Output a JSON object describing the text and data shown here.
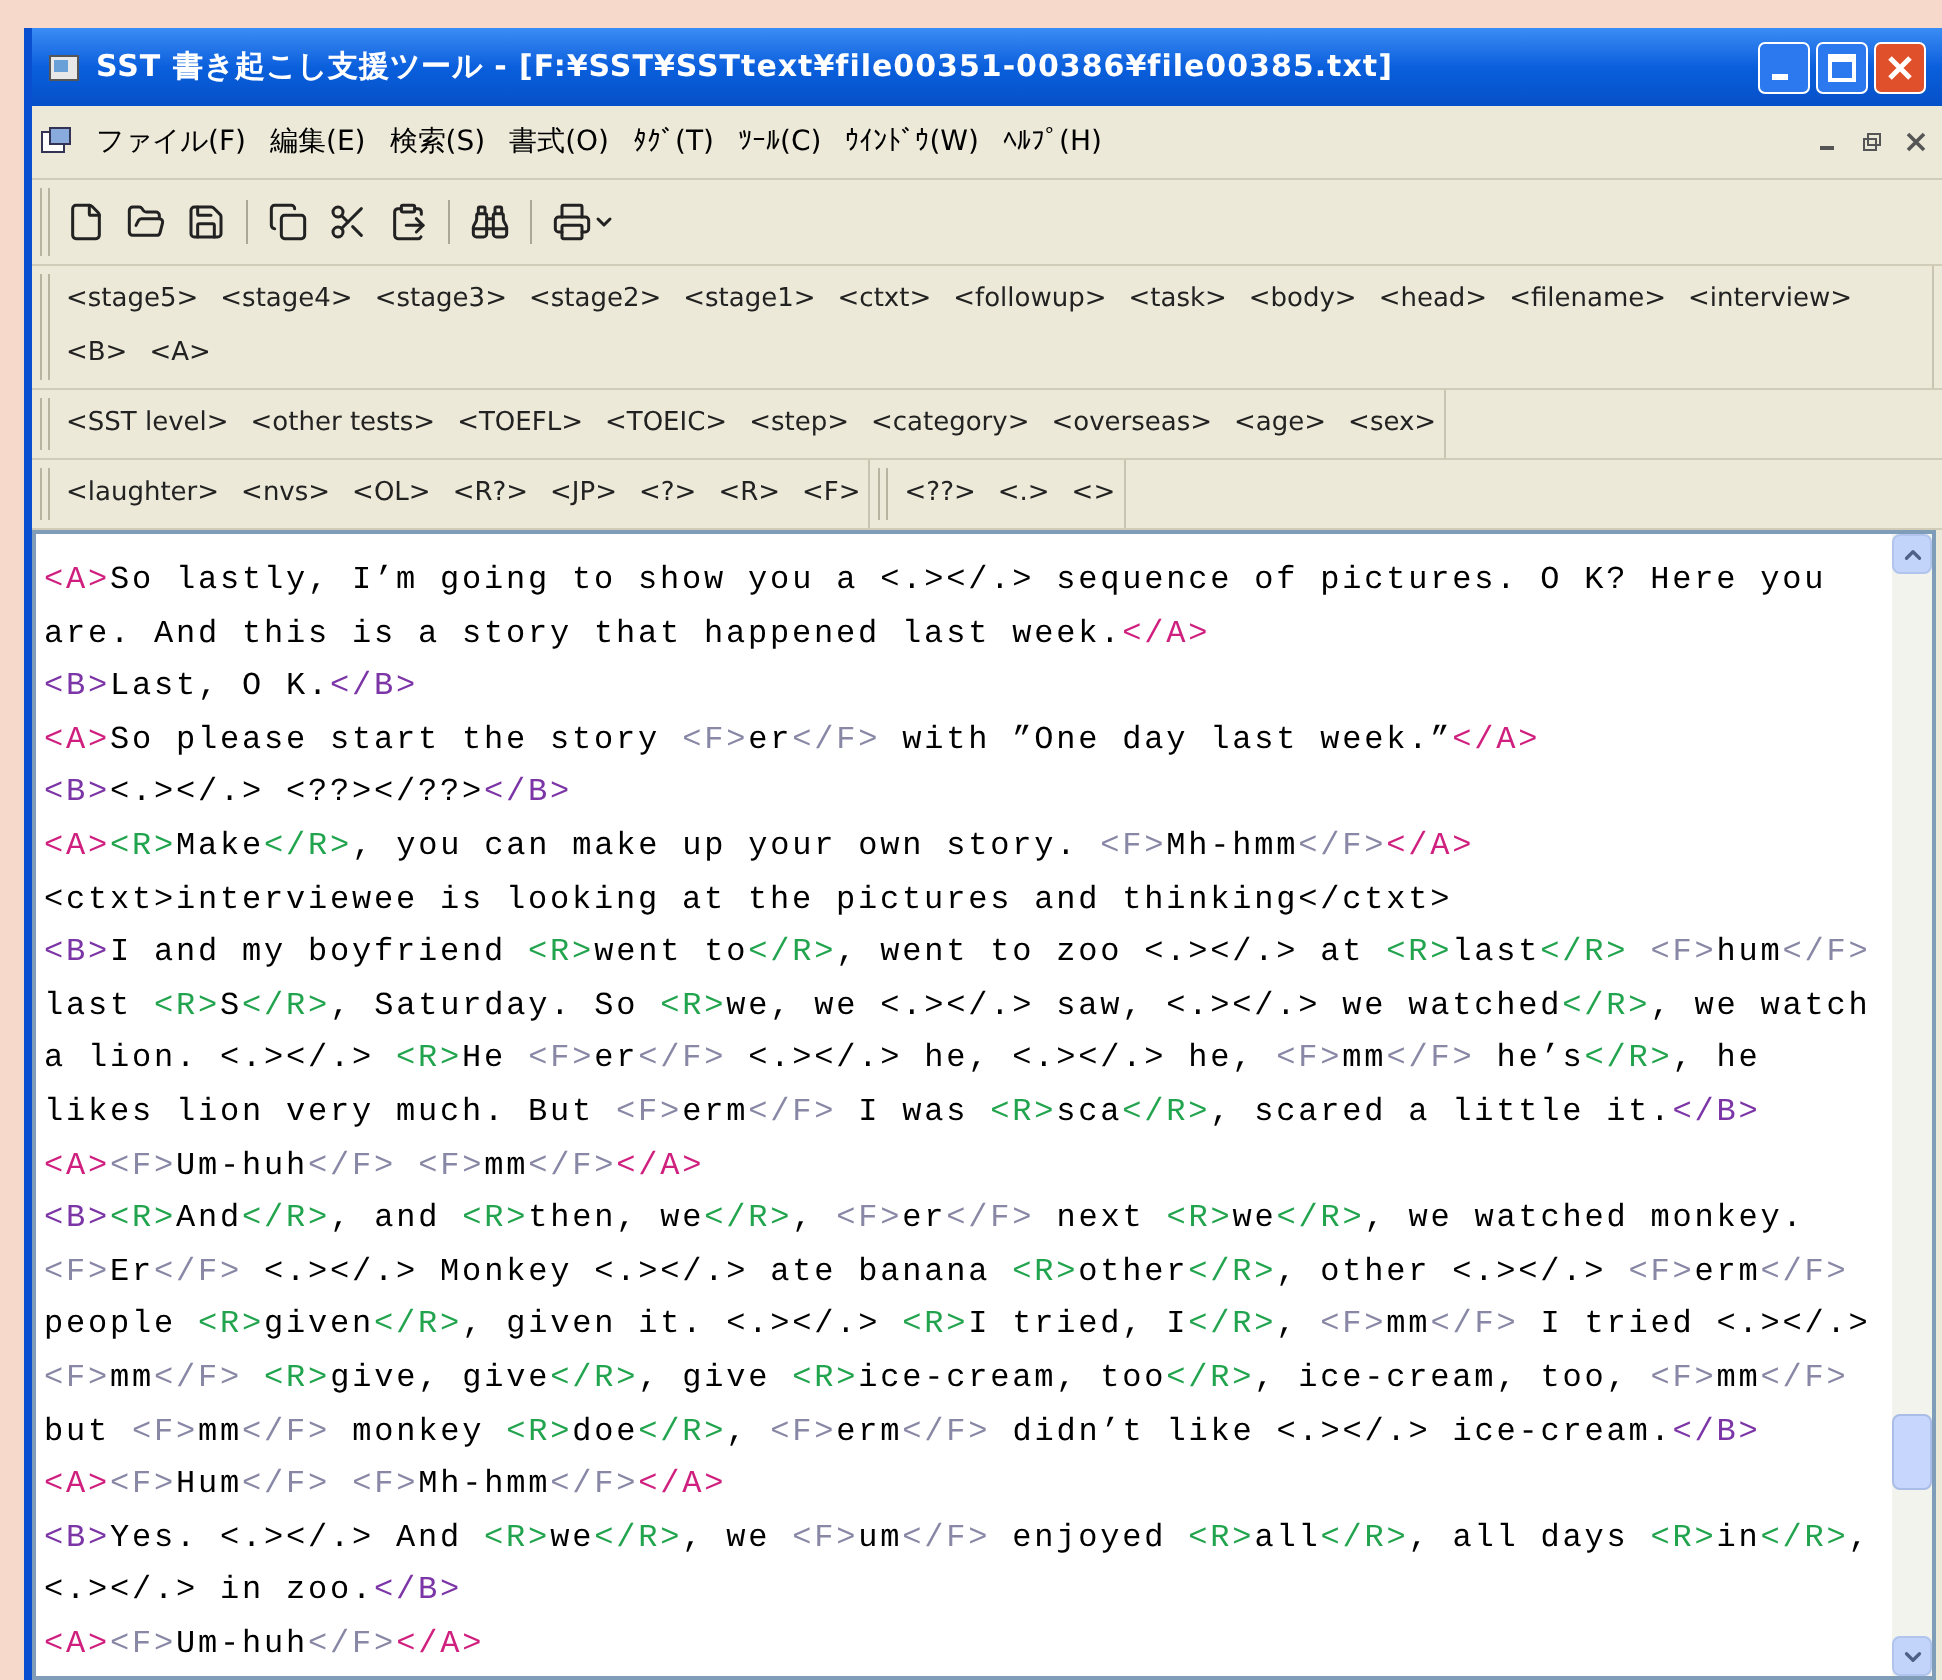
{
  "window": {
    "title": "SST 書き起こし支援ツール - [F:¥SST¥SSTtext¥file00351-00386¥file00385.txt]"
  },
  "menu": [
    "ファイル(F)",
    "編集(E)",
    "検索(S)",
    "書式(O)",
    "ﾀｸﾞ(T)",
    "ﾂｰﾙ(C)",
    "ｳｲﾝﾄﾞｳ(W)",
    "ﾍﾙﾌﾟ(H)"
  ],
  "toolbar": [
    {
      "kind": "new"
    },
    {
      "kind": "open"
    },
    {
      "kind": "save"
    },
    {
      "kind": "separator"
    },
    {
      "kind": "copy"
    },
    {
      "kind": "cut"
    },
    {
      "kind": "paste"
    },
    {
      "kind": "separator"
    },
    {
      "kind": "find"
    },
    {
      "kind": "separator"
    },
    {
      "kind": "print"
    }
  ],
  "tag_bars": [
    {
      "bands": [
        [
          "<stage5>",
          "<stage4>",
          "<stage3>",
          "<stage2>",
          "<stage1>",
          "<ctxt>",
          "<followup>",
          "<task>",
          "<body>",
          "<head>",
          "<filename>",
          "<interview>",
          "<B>",
          "<A>"
        ]
      ]
    },
    {
      "bands": [
        [
          "<SST level>",
          "<other tests>",
          "<TOEFL>",
          "<TOEIC>",
          "<step>",
          "<category>",
          "<overseas>",
          "<age>",
          "<sex>"
        ]
      ]
    },
    {
      "bands": [
        [
          "<laughter>",
          "<nvs>",
          "<OL>",
          "<R?>",
          "<JP>",
          "<?>",
          "<R>",
          "<F>"
        ],
        [
          "<??>",
          "<.>",
          "<>"
        ]
      ]
    }
  ],
  "editor": {
    "lines": [
      [
        {
          "kind": "speaker_a",
          "text": "<A>"
        },
        {
          "kind": "plain",
          "text": "So lastly, I’m going to show you a <.></.> sequence of pictures. O K? Here you"
        }
      ],
      [
        {
          "kind": "plain",
          "text": "are. And this is a story that happened last week."
        },
        {
          "kind": "speaker_a",
          "text": "</A>"
        }
      ],
      [
        {
          "kind": "speaker_b",
          "text": "<B>"
        },
        {
          "kind": "plain",
          "text": "Last, O K."
        },
        {
          "kind": "speaker_b",
          "text": "</B>"
        }
      ],
      [
        {
          "kind": "speaker_a",
          "text": "<A>"
        },
        {
          "kind": "plain",
          "text": "So please start the story "
        },
        {
          "kind": "filler",
          "text": "<F>"
        },
        {
          "kind": "plain",
          "text": "er"
        },
        {
          "kind": "filler",
          "text": "</F>"
        },
        {
          "kind": "plain",
          "text": " with ”One day last week.”"
        },
        {
          "kind": "speaker_a",
          "text": "</A>"
        }
      ],
      [
        {
          "kind": "speaker_b",
          "text": "<B>"
        },
        {
          "kind": "plain",
          "text": "<.></.> <??></??>"
        },
        {
          "kind": "speaker_b",
          "text": "</B>"
        }
      ],
      [
        {
          "kind": "speaker_a",
          "text": "<A>"
        },
        {
          "kind": "repair",
          "text": "<R>"
        },
        {
          "kind": "plain",
          "text": "Make"
        },
        {
          "kind": "repair",
          "text": "</R>"
        },
        {
          "kind": "plain",
          "text": ", you can make up your own story. "
        },
        {
          "kind": "filler",
          "text": "<F>"
        },
        {
          "kind": "plain",
          "text": "Mh-hmm"
        },
        {
          "kind": "filler",
          "text": "</F>"
        },
        {
          "kind": "speaker_a",
          "text": "</A>"
        }
      ],
      [
        {
          "kind": "plain",
          "text": "<ctxt>interviewee is looking at the pictures and thinking</ctxt>"
        }
      ],
      [
        {
          "kind": "speaker_b",
          "text": "<B>"
        },
        {
          "kind": "plain",
          "text": "I and my boyfriend "
        },
        {
          "kind": "repair",
          "text": "<R>"
        },
        {
          "kind": "plain",
          "text": "went to"
        },
        {
          "kind": "repair",
          "text": "</R>"
        },
        {
          "kind": "plain",
          "text": ", went to zoo <.></.> at "
        },
        {
          "kind": "repair",
          "text": "<R>"
        },
        {
          "kind": "plain",
          "text": "last"
        },
        {
          "kind": "repair",
          "text": "</R>"
        },
        {
          "kind": "filler",
          "text": " <F>"
        },
        {
          "kind": "plain",
          "text": "hum"
        },
        {
          "kind": "filler",
          "text": "</F>"
        }
      ],
      [
        {
          "kind": "plain",
          "text": "last "
        },
        {
          "kind": "repair",
          "text": "<R>"
        },
        {
          "kind": "plain",
          "text": "S"
        },
        {
          "kind": "repair",
          "text": "</R>"
        },
        {
          "kind": "plain",
          "text": ", Saturday. So "
        },
        {
          "kind": "repair",
          "text": "<R>"
        },
        {
          "kind": "plain",
          "text": "we, we <.></.> saw, <.></.> we watched"
        },
        {
          "kind": "repair",
          "text": "</R>"
        },
        {
          "kind": "plain",
          "text": ", we watch"
        }
      ],
      [
        {
          "kind": "plain",
          "text": "a lion. <.></.> "
        },
        {
          "kind": "repair",
          "text": "<R>"
        },
        {
          "kind": "plain",
          "text": "He "
        },
        {
          "kind": "filler",
          "text": "<F>"
        },
        {
          "kind": "plain",
          "text": "er"
        },
        {
          "kind": "filler",
          "text": "</F>"
        },
        {
          "kind": "plain",
          "text": " <.></.> he, <.></.> he, "
        },
        {
          "kind": "filler",
          "text": "<F>"
        },
        {
          "kind": "plain",
          "text": "mm"
        },
        {
          "kind": "filler",
          "text": "</F>"
        },
        {
          "kind": "plain",
          "text": " he’s"
        },
        {
          "kind": "repair",
          "text": "</R>"
        },
        {
          "kind": "plain",
          "text": ", he"
        }
      ],
      [
        {
          "kind": "plain",
          "text": "likes lion very much. But "
        },
        {
          "kind": "filler",
          "text": "<F>"
        },
        {
          "kind": "plain",
          "text": "erm"
        },
        {
          "kind": "filler",
          "text": "</F>"
        },
        {
          "kind": "plain",
          "text": " I was "
        },
        {
          "kind": "repair",
          "text": "<R>"
        },
        {
          "kind": "plain",
          "text": "sca"
        },
        {
          "kind": "repair",
          "text": "</R>"
        },
        {
          "kind": "plain",
          "text": ", scared a little it."
        },
        {
          "kind": "speaker_b",
          "text": "</B>"
        }
      ],
      [
        {
          "kind": "speaker_a",
          "text": "<A>"
        },
        {
          "kind": "filler",
          "text": "<F>"
        },
        {
          "kind": "plain",
          "text": "Um-huh"
        },
        {
          "kind": "filler",
          "text": "</F>"
        },
        {
          "kind": "filler",
          "text": " <F>"
        },
        {
          "kind": "plain",
          "text": "mm"
        },
        {
          "kind": "filler",
          "text": "</F>"
        },
        {
          "kind": "speaker_a",
          "text": "</A>"
        }
      ],
      [
        {
          "kind": "speaker_b",
          "text": "<B>"
        },
        {
          "kind": "repair",
          "text": "<R>"
        },
        {
          "kind": "plain",
          "text": "And"
        },
        {
          "kind": "repair",
          "text": "</R>"
        },
        {
          "kind": "plain",
          "text": ", and "
        },
        {
          "kind": "repair",
          "text": "<R>"
        },
        {
          "kind": "plain",
          "text": "then, we"
        },
        {
          "kind": "repair",
          "text": "</R>"
        },
        {
          "kind": "plain",
          "text": ", "
        },
        {
          "kind": "filler",
          "text": "<F>"
        },
        {
          "kind": "plain",
          "text": "er"
        },
        {
          "kind": "filler",
          "text": "</F>"
        },
        {
          "kind": "plain",
          "text": " next "
        },
        {
          "kind": "repair",
          "text": "<R>"
        },
        {
          "kind": "plain",
          "text": "we"
        },
        {
          "kind": "repair",
          "text": "</R>"
        },
        {
          "kind": "plain",
          "text": ", we watched monkey."
        }
      ],
      [
        {
          "kind": "filler",
          "text": "<F>"
        },
        {
          "kind": "plain",
          "text": "Er"
        },
        {
          "kind": "filler",
          "text": "</F>"
        },
        {
          "kind": "plain",
          "text": " <.></.> Monkey <.></.> ate banana "
        },
        {
          "kind": "repair",
          "text": "<R>"
        },
        {
          "kind": "plain",
          "text": "other"
        },
        {
          "kind": "repair",
          "text": "</R>"
        },
        {
          "kind": "plain",
          "text": ", other <.></.> "
        },
        {
          "kind": "filler",
          "text": "<F>"
        },
        {
          "kind": "plain",
          "text": "erm"
        },
        {
          "kind": "filler",
          "text": "</F>"
        }
      ],
      [
        {
          "kind": "plain",
          "text": "people "
        },
        {
          "kind": "repair",
          "text": "<R>"
        },
        {
          "kind": "plain",
          "text": "given"
        },
        {
          "kind": "repair",
          "text": "</R>"
        },
        {
          "kind": "plain",
          "text": ", given it. <.></.> "
        },
        {
          "kind": "repair",
          "text": "<R>"
        },
        {
          "kind": "plain",
          "text": "I tried, I"
        },
        {
          "kind": "repair",
          "text": "</R>"
        },
        {
          "kind": "plain",
          "text": ", "
        },
        {
          "kind": "filler",
          "text": "<F>"
        },
        {
          "kind": "plain",
          "text": "mm"
        },
        {
          "kind": "filler",
          "text": "</F>"
        },
        {
          "kind": "plain",
          "text": " I tried <.></.>"
        }
      ],
      [
        {
          "kind": "filler",
          "text": "<F>"
        },
        {
          "kind": "plain",
          "text": "mm"
        },
        {
          "kind": "filler",
          "text": "</F>"
        },
        {
          "kind": "repair",
          "text": " <R>"
        },
        {
          "kind": "plain",
          "text": "give, give"
        },
        {
          "kind": "repair",
          "text": "</R>"
        },
        {
          "kind": "plain",
          "text": ", give "
        },
        {
          "kind": "repair",
          "text": "<R>"
        },
        {
          "kind": "plain",
          "text": "ice-cream, too"
        },
        {
          "kind": "repair",
          "text": "</R>"
        },
        {
          "kind": "plain",
          "text": ", ice-cream, too, "
        },
        {
          "kind": "filler",
          "text": "<F>"
        },
        {
          "kind": "plain",
          "text": "mm"
        },
        {
          "kind": "filler",
          "text": "</F>"
        }
      ],
      [
        {
          "kind": "plain",
          "text": "but "
        },
        {
          "kind": "filler",
          "text": "<F>"
        },
        {
          "kind": "plain",
          "text": "mm"
        },
        {
          "kind": "filler",
          "text": "</F>"
        },
        {
          "kind": "plain",
          "text": " monkey "
        },
        {
          "kind": "repair",
          "text": "<R>"
        },
        {
          "kind": "plain",
          "text": "doe"
        },
        {
          "kind": "repair",
          "text": "</R>"
        },
        {
          "kind": "plain",
          "text": ", "
        },
        {
          "kind": "filler",
          "text": "<F>"
        },
        {
          "kind": "plain",
          "text": "erm"
        },
        {
          "kind": "filler",
          "text": "</F>"
        },
        {
          "kind": "plain",
          "text": " didn’t like <.></.> ice-cream."
        },
        {
          "kind": "speaker_b",
          "text": "</B>"
        }
      ],
      [
        {
          "kind": "speaker_a",
          "text": "<A>"
        },
        {
          "kind": "filler",
          "text": "<F>"
        },
        {
          "kind": "plain",
          "text": "Hum"
        },
        {
          "kind": "filler",
          "text": "</F>"
        },
        {
          "kind": "filler",
          "text": " <F>"
        },
        {
          "kind": "plain",
          "text": "Mh-hmm"
        },
        {
          "kind": "filler",
          "text": "</F>"
        },
        {
          "kind": "speaker_a",
          "text": "</A>"
        }
      ],
      [
        {
          "kind": "speaker_b",
          "text": "<B>"
        },
        {
          "kind": "plain",
          "text": "Yes. <.></.> And "
        },
        {
          "kind": "repair",
          "text": "<R>"
        },
        {
          "kind": "plain",
          "text": "we"
        },
        {
          "kind": "repair",
          "text": "</R>"
        },
        {
          "kind": "plain",
          "text": ", we "
        },
        {
          "kind": "filler",
          "text": "<F>"
        },
        {
          "kind": "plain",
          "text": "um"
        },
        {
          "kind": "filler",
          "text": "</F>"
        },
        {
          "kind": "plain",
          "text": " enjoyed "
        },
        {
          "kind": "repair",
          "text": "<R>"
        },
        {
          "kind": "plain",
          "text": "all"
        },
        {
          "kind": "repair",
          "text": "</R>"
        },
        {
          "kind": "plain",
          "text": ", all days "
        },
        {
          "kind": "repair",
          "text": "<R>"
        },
        {
          "kind": "plain",
          "text": "in"
        },
        {
          "kind": "repair",
          "text": "</R>"
        },
        {
          "kind": "plain",
          "text": ","
        }
      ],
      [
        {
          "kind": "plain",
          "text": "<.></.> in zoo."
        },
        {
          "kind": "speaker_b",
          "text": "</B>"
        }
      ],
      [
        {
          "kind": "speaker_a",
          "text": "<A>"
        },
        {
          "kind": "filler",
          "text": "<F>"
        },
        {
          "kind": "plain",
          "text": "Um-huh"
        },
        {
          "kind": "filler",
          "text": "</F>"
        },
        {
          "kind": "speaker_a",
          "text": "</A>"
        }
      ]
    ]
  }
}
